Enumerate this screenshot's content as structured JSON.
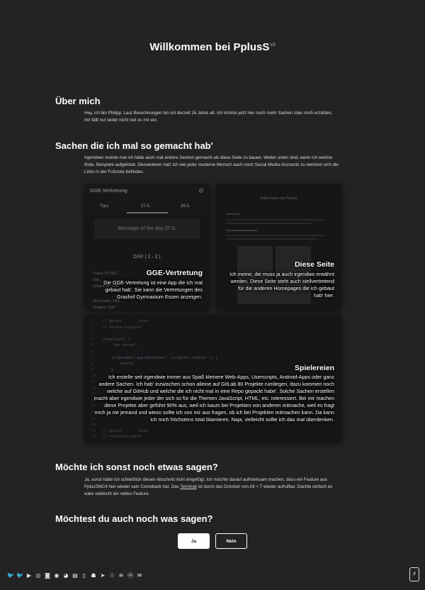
{
  "header": {
    "title": "Willkommen bei PplusS",
    "version": "V3"
  },
  "about": {
    "heading": "Über mich",
    "text": "Hey, ich bin Philipp. Laut Berechnungen bin ich derzeit 16 Jahre alt. Ich könnte jetzt hier noch mehr Sachen über mich erzählen, mir fällt nur leider nicht viel zu mir ein."
  },
  "projects": {
    "heading": "Sachen die ich mal so gemacht hab'",
    "text": "Irgendwer meinte mal ich hätte auch mal andere Sachen gemacht als diese Seite zu bauen. Weiter unten sind, wenn ich welche finde, Beispiele aufgelistet. Desweiteren hab' ich wie jeder moderne Mensch auch noch Social Media-Accounts zu welchen sich die Links in der Fußzeile befinden.",
    "cards": [
      {
        "title": "GGE-Vertretung",
        "desc": "Die GGE-Vertretung ist eine App die ich mal gebaut hab'. Sie kann die Vertretungen des Grashof Gymnasium Essen anzeigen.",
        "mock": {
          "header": "GGE-Vertretung",
          "tabs": [
            "Tips",
            "27.5.",
            "28.5."
          ],
          "motd": "Message of the day 27.5.",
          "entry": "DAF | 1 - 2 |",
          "lines": [
            "Class: (P1SE)",
            "Dat...",
            "Unterricht: DAF",
            "Old Room: U83",
            "Subject: DAF"
          ]
        }
      },
      {
        "title": "Diese Seite",
        "desc": "Ich meine, die muss ja auch irgendwo erwähnt werden. Diese Seite steht auch stellvertretend für die anderen Homepages die ich gebaut hab' hier.",
        "mock": {
          "title": "Willkommen bei PplusS"
        }
      },
      {
        "title": "Spielereien",
        "desc": "Ich erstelle seit irgendwie immer aus Spaß kleinere Web-Apps, Userscripts, Android-Apps oder ganz andere Sachen. Ich hab' inzwischen schon alleine auf GitLab 80 Projekte rumliegen, dazu kommen noch welche auf GitHub und welche die ich nicht mal in eine Repo gepackt habe'. Solche Sachen erstellen macht aber irgendwie jeder der sich so für die Themen JavaScript, HTML, etc. interessiert. Bei mir machen diese Projekte aber geführt 90% aus, weil ich kaum bei Projekten von anderen mitmache, weil es fragt mich ja nie jemand und wieso sollte ich von mir aus fragen, ob ich bei Projekten mitmachen kann. Da kann ich mich höchstens total blamieren. Naja, vielleicht sollte ich das mal überdenken.",
        "mock": {
          "code": [
            "// @grant        none",
            "// ==/UserScript==",
            "",
            "(function() {",
            "    'use strict';",
            "",
            "    if(document.querySelector('.rs-author-contact')) {",
            "        return;",
            "    }",
            "",
            "",
            "",
            "",
            "",
            "",
            "",
            "",
            "",
            "// @grant        none",
            "// ==/UserScript=="
          ]
        }
      }
    ]
  },
  "extra": {
    "heading": "Möchte ich sonst noch etwas sagen?",
    "text_before": "Ja, sonst hätte ich schließlich diesen Abschnitt nicht eingefügt. Ich möchte darauf aufmerksam machen, dass ein Feature aus PplusSMC4 hier wieder sein Comeback hat. Das ",
    "link": "Terminal",
    "text_after": " ist durch das Drücken von Alt + T wieder aufrufbar. Dachte einfach es wäre vielleicht ein nettes Feature."
  },
  "feedback": {
    "heading": "Möchtest du auch noch was sagen?",
    "yes_label": "Ja",
    "no_label": "Nein"
  },
  "footer": {
    "icons": [
      "twitter-icon",
      "twitter-icon",
      "youtube-icon",
      "instagram-icon",
      "discord-icon",
      "steam-icon",
      "spotify-icon",
      "twitch-icon",
      "book-icon",
      "android-icon",
      "telegram-icon",
      "snapchat-icon",
      "soundcloud-icon",
      "mastodon-icon",
      "mail-icon"
    ],
    "glyphs": [
      "🐦",
      "🐦",
      "▶",
      "◎",
      "◙",
      "◉",
      "◕",
      "▤",
      "▯",
      "☗",
      "➤",
      "☃",
      "≋",
      "ⓜ",
      "✉"
    ],
    "bolt": "⚡"
  },
  "colors": {
    "background": "#232323",
    "text": "#e6e6e6",
    "accent": "#ffffff"
  }
}
